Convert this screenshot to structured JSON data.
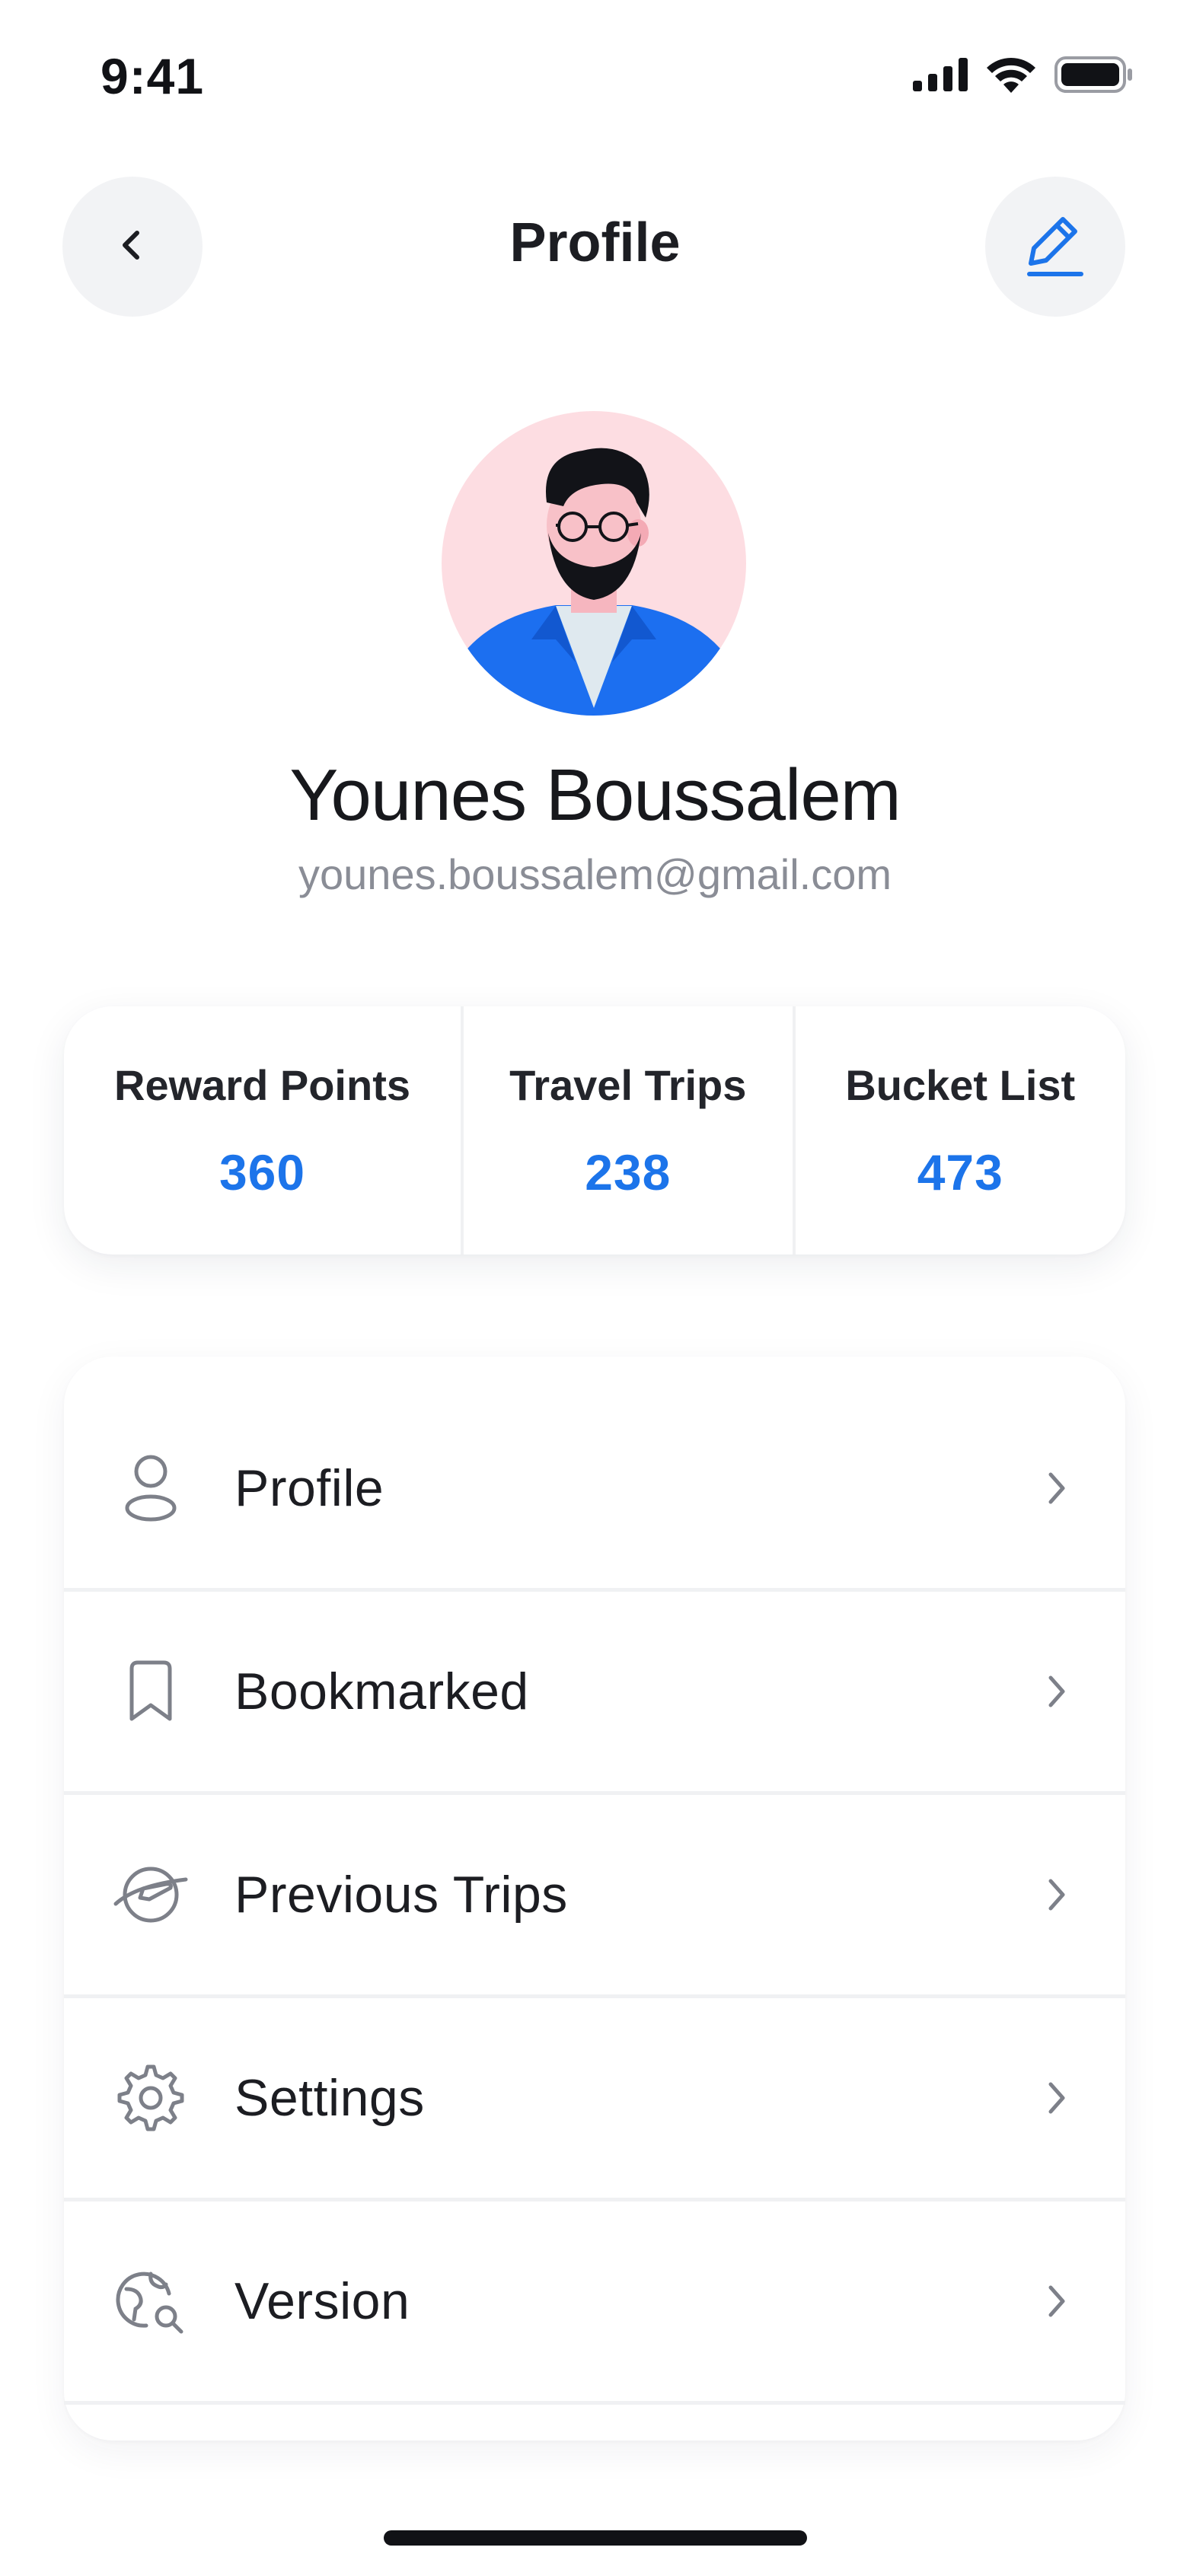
{
  "status_bar": {
    "time": "9:41",
    "icons": [
      "cellular-signal-icon",
      "wifi-icon",
      "battery-icon"
    ]
  },
  "header": {
    "title": "Profile",
    "back_icon": "chevron-left-icon",
    "edit_icon": "pencil-edit-icon"
  },
  "user": {
    "name": "Younes Boussalem",
    "email": "younes.boussalem@gmail.com",
    "avatar": "illustrated-avatar-man-beard-glasses"
  },
  "stats": [
    {
      "label": "Reward Points",
      "value": "360"
    },
    {
      "label": "Travel Trips",
      "value": "238"
    },
    {
      "label": "Bucket List",
      "value": "473"
    }
  ],
  "menu": [
    {
      "label": "Profile",
      "icon": "user-icon"
    },
    {
      "label": "Bookmarked",
      "icon": "bookmark-icon"
    },
    {
      "label": "Previous Trips",
      "icon": "plane-globe-icon"
    },
    {
      "label": "Settings",
      "icon": "gear-icon"
    },
    {
      "label": "Version",
      "icon": "globe-search-icon"
    }
  ],
  "colors": {
    "accent": "#1c74ea",
    "text_primary": "#1c1d22",
    "text_secondary": "#8a8d96",
    "button_bg": "#f2f3f5",
    "avatar_bg": "#fddde2"
  }
}
